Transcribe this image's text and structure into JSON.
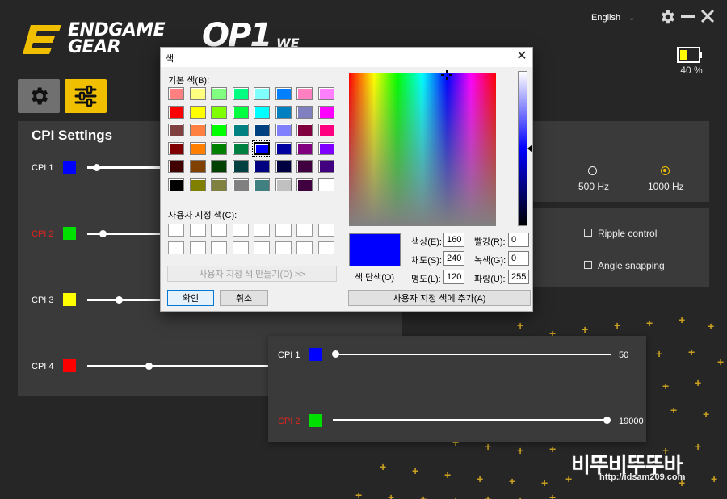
{
  "app": {
    "brand_line1": "ENDGAME",
    "brand_line2": "GEAR",
    "model": "OP1",
    "model_suffix": "WE",
    "language": "English",
    "battery": {
      "percent_label": "40 %",
      "level": 0.4
    },
    "accent_color": "#f0c000"
  },
  "cpi": {
    "title": "CPI Settings",
    "items": [
      {
        "label": "CPI 1",
        "color": "#0000ff",
        "level": 0.03
      },
      {
        "label": "CPI 2",
        "color": "#00e000",
        "level": 0.06
      },
      {
        "label": "CPI 3",
        "color": "#ffff00",
        "level": 0.18
      },
      {
        "label": "CPI 4",
        "color": "#ff0000",
        "level": 0.36
      }
    ]
  },
  "polling": {
    "options": [
      "500 Hz",
      "1000 Hz"
    ],
    "selected": "1000 Hz"
  },
  "options": {
    "ripple": "Ripple control",
    "angle": "Angle snapping"
  },
  "zoom": {
    "items": [
      {
        "label": "CPI 1",
        "color": "#0000ff",
        "value": "50"
      },
      {
        "label": "CPI 2",
        "color": "#00e000",
        "value": "19000"
      }
    ]
  },
  "dialog": {
    "title": "색",
    "basic_label": "기본 색(B):",
    "custom_label": "사용자 지정 색(C):",
    "define_button": "사용자 지정 색 만들기(D) >>",
    "ok": "확인",
    "cancel": "취소",
    "solid_label": "색|단색(O)",
    "hue_label": "색상(E):",
    "hue": "160",
    "sat_label": "채도(S):",
    "sat": "240",
    "lum_label": "명도(L):",
    "lum": "120",
    "red_label": "빨강(R):",
    "red": "0",
    "green_label": "녹색(G):",
    "green": "0",
    "blue_label": "파랑(U):",
    "blue": "255",
    "add_button": "사용자 지정 색에 추가(A)",
    "basic_colors": [
      [
        "#ff8080",
        "#ffff80",
        "#80ff80",
        "#00ff80",
        "#80ffff",
        "#0080ff",
        "#ff80c0",
        "#ff80ff"
      ],
      [
        "#ff0000",
        "#ffff00",
        "#80ff00",
        "#00ff40",
        "#00ffff",
        "#0080c0",
        "#8080c0",
        "#ff00ff"
      ],
      [
        "#804040",
        "#ff8040",
        "#00ff00",
        "#008080",
        "#004080",
        "#8080ff",
        "#800040",
        "#ff0080"
      ],
      [
        "#800000",
        "#ff8000",
        "#008000",
        "#008040",
        "#0000ff",
        "#0000a0",
        "#800080",
        "#8000ff"
      ],
      [
        "#400000",
        "#804000",
        "#004000",
        "#004040",
        "#000080",
        "#000040",
        "#400040",
        "#400080"
      ],
      [
        "#000000",
        "#808000",
        "#808040",
        "#808080",
        "#408080",
        "#c0c0c0",
        "#400040",
        "#ffffff"
      ]
    ],
    "selected": [
      3,
      4
    ]
  },
  "watermark": {
    "text": "비뚜비뚜뚜바",
    "url": "http://idsam209.com"
  }
}
